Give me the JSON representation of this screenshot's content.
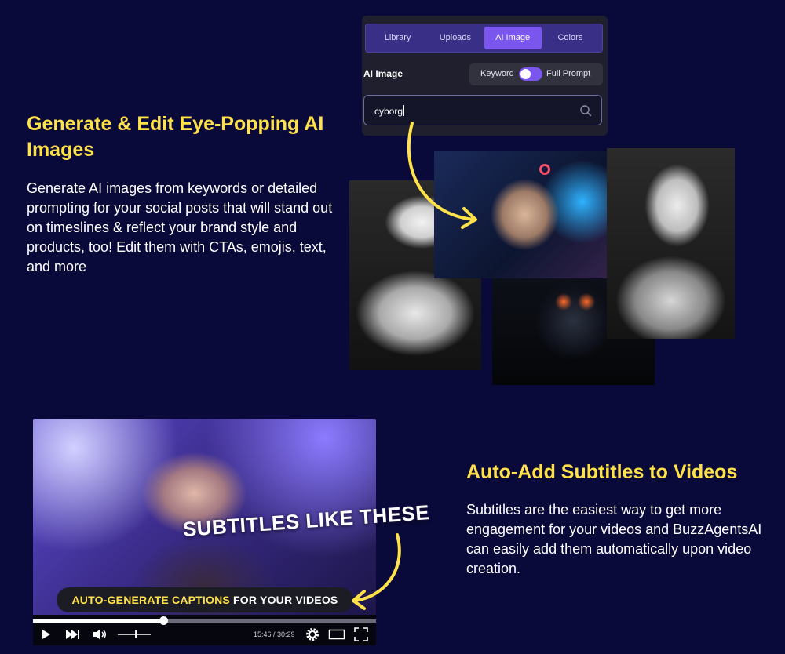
{
  "section1": {
    "heading": "Generate & Edit Eye-Popping AI Images",
    "body": "Generate AI images from keywords or detailed prompting for your social posts that will stand out on timeslines & reflect your brand style and products, too! Edit them with CTAs, emojis, text, and more"
  },
  "panel": {
    "tabs": [
      "Library",
      "Uploads",
      "AI Image",
      "Colors"
    ],
    "active_tab": "AI Image",
    "label": "AI Image",
    "toggle_left": "Keyword",
    "toggle_right": "Full Prompt",
    "search_value": "cyborg",
    "search_icon": "magnifier-icon",
    "accent": "#7a56ee"
  },
  "video": {
    "subtitle_overlay": "SUBTITLES LIKE THESE",
    "caption_highlight": "AUTO-GENERATE CAPTIONS",
    "caption_rest": " FOR YOUR VIDEOS",
    "time": "15:46 / 30:29",
    "progress": 0.38,
    "volume": 0.55
  },
  "section2": {
    "heading": "Auto-Add Subtitles to Videos",
    "body": "Subtitles are the easiest way to get more engagement for your videos and BuzzAgentsAI can easily add them automatically upon video creation."
  },
  "colors": {
    "background": "#0a0a3a",
    "heading": "#ffe14a"
  }
}
